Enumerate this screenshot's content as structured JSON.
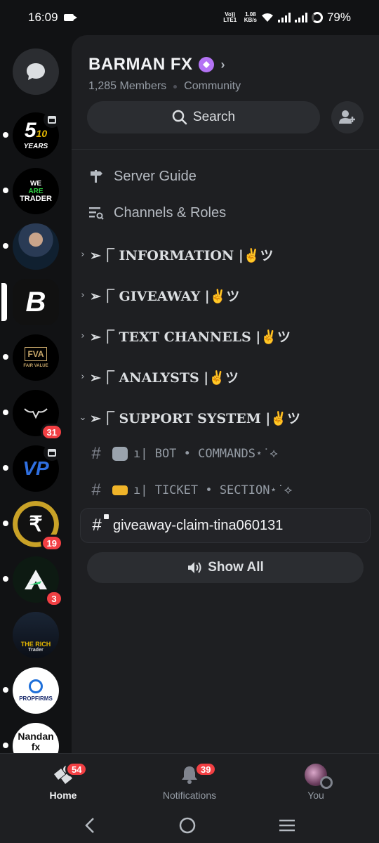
{
  "status_bar": {
    "time": "16:09",
    "network_top": "Vo)) LTE1",
    "speed_value": "1.08",
    "speed_unit": "KB/s",
    "battery": "79%"
  },
  "server_rail": {
    "items": [
      {
        "id": "dms",
        "icon": "chat-bubble-icon"
      },
      {
        "id": "server-5years",
        "text": "5",
        "subtext": "10 YEARS",
        "unread": true,
        "event": true
      },
      {
        "id": "server-we-are-trader",
        "text": "WE ARE TRADER",
        "unread": true
      },
      {
        "id": "server-photo",
        "unread": true
      },
      {
        "id": "server-b",
        "text": "B",
        "active": true
      },
      {
        "id": "server-fva",
        "text": "FVA",
        "subtext": "FAIR VALUE",
        "unread": true
      },
      {
        "id": "server-bull",
        "unread": true,
        "badge": "31"
      },
      {
        "id": "server-vp",
        "text": "VP",
        "unread": true,
        "event": true
      },
      {
        "id": "server-rupee",
        "text": "₹",
        "unread": true,
        "badge": "19"
      },
      {
        "id": "server-a",
        "text": "A",
        "unread": true,
        "badge": "3"
      },
      {
        "id": "server-rich-trader",
        "text": "THE RICH",
        "subtext": "Trader"
      },
      {
        "id": "server-propfirms",
        "text": "PROPFIRMS",
        "unread": true
      },
      {
        "id": "server-nandan",
        "text": "Nandan fx",
        "unread": true
      }
    ]
  },
  "server": {
    "name": "BARMAN FX",
    "members": "1,285 Members",
    "type": "Community",
    "search_label": "Search"
  },
  "menu": {
    "guide": "Server Guide",
    "roles": "Channels & Roles"
  },
  "categories": [
    {
      "label": "➢⎾ INFORMATION |✌️ツ",
      "expanded": false
    },
    {
      "label": "➢⎾ GIVEAWAY |✌️ツ",
      "expanded": false
    },
    {
      "label": "➢⎾ TEXT CHANNELS |✌️ツ",
      "expanded": false
    },
    {
      "label": "➢⎾ ANALYSTS |✌️ツ",
      "expanded": false
    },
    {
      "label": "➢⎾ SUPPORT SYSTEM |✌️ツ",
      "expanded": true
    }
  ],
  "channels": [
    {
      "label": "ı| BOT • COMMANDS⋆˙⟡",
      "emoji": "robot"
    },
    {
      "label": "ı| TICKET • SECTION⋆˙⟡",
      "emoji": "ticket"
    },
    {
      "label": "giveaway-claim-tina060131",
      "locked": true,
      "selected": true
    }
  ],
  "show_all": "Show All",
  "bottom_nav": {
    "home": {
      "label": "Home",
      "badge": "54"
    },
    "notifications": {
      "label": "Notifications",
      "badge": "39"
    },
    "you": {
      "label": "You"
    }
  },
  "colors": {
    "background": "#111214",
    "panel": "#1e1f22",
    "button": "#2b2d31",
    "badge_red": "#f23f43",
    "boost_purple": "#b473f5"
  }
}
